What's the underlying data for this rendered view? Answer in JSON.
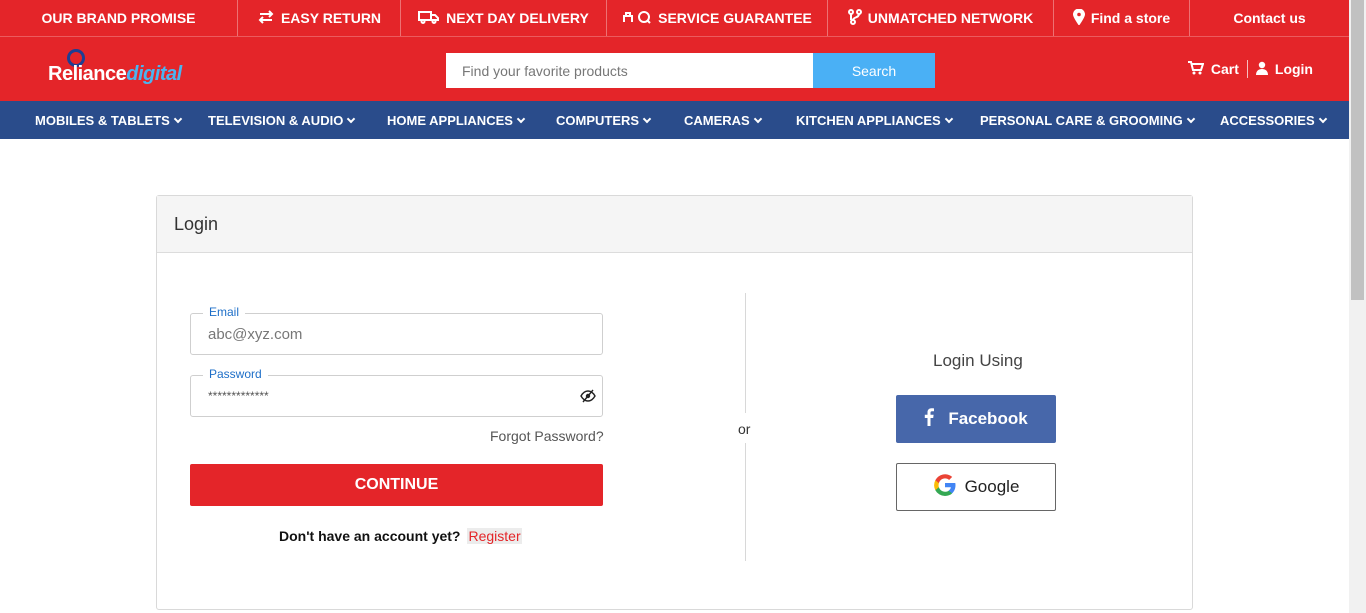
{
  "promise_bar": [
    {
      "label": "OUR BRAND PROMISE",
      "icon": ""
    },
    {
      "label": "EASY RETURN",
      "icon": "return-arrows-icon"
    },
    {
      "label": "NEXT DAY DELIVERY",
      "icon": "truck-icon"
    },
    {
      "label": "SERVICE GUARANTEE",
      "icon": "service-icon"
    },
    {
      "label": "UNMATCHED NETWORK",
      "icon": "network-icon"
    },
    {
      "label": "Find a store",
      "icon": "map-pin-icon"
    },
    {
      "label": "Contact us",
      "icon": ""
    }
  ],
  "header": {
    "logo_main": "Reliance",
    "logo_accent": "digital",
    "search_placeholder": "Find your favorite products",
    "search_button": "Search",
    "cart_label": "Cart",
    "login_label": "Login"
  },
  "categories": [
    "MOBILES & TABLETS",
    "TELEVISION & AUDIO",
    "HOME APPLIANCES",
    "COMPUTERS",
    "CAMERAS",
    "KITCHEN APPLIANCES",
    "PERSONAL CARE & GROOMING",
    "ACCESSORIES"
  ],
  "login": {
    "title": "Login",
    "email_label": "Email",
    "email_value": "abc@xyz.com",
    "password_label": "Password",
    "password_value": "*************",
    "forgot": "Forgot Password?",
    "continue": "CONTINUE",
    "register_question": "Don't have an account yet?",
    "register_link": "Register",
    "or": "or",
    "login_using": "Login Using",
    "facebook": "Facebook",
    "google": "Google"
  },
  "colors": {
    "brand_red": "#e42529",
    "nav_blue": "#2a4c8b",
    "search_blue": "#4ab0f5",
    "facebook_blue": "#4767aa"
  }
}
